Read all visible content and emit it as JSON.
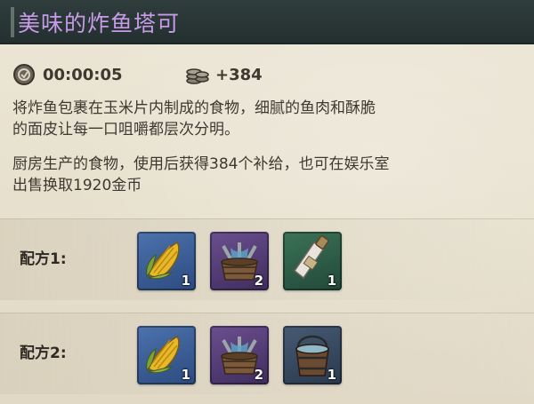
{
  "title": "美味的炸鱼塔可",
  "stats": {
    "time": {
      "icon": "coin-timer-icon",
      "value": "00:00:05"
    },
    "supply": {
      "icon": "coin-stack-icon",
      "value": "+384"
    }
  },
  "description": {
    "line1": "将炸鱼包裹在玉米片内制成的食物，细腻的鱼肉和酥脆",
    "line2": "的面皮让每一口咀嚼都层次分明。",
    "line3": "厨房生产的食物，使用后获得384个补给，也可在娱乐室",
    "line4": "出售换取1920金币"
  },
  "recipes": [
    {
      "label": "配方1:",
      "items": [
        {
          "icon": "corn-icon",
          "qty": "1",
          "rarity": "blue"
        },
        {
          "icon": "fish-basket-icon",
          "qty": "2",
          "rarity": "purple"
        },
        {
          "icon": "salt-bottle-icon",
          "qty": "1",
          "rarity": "green"
        }
      ]
    },
    {
      "label": "配方2:",
      "items": [
        {
          "icon": "corn-icon",
          "qty": "1",
          "rarity": "blue"
        },
        {
          "icon": "fish-basket-icon",
          "qty": "2",
          "rarity": "purple"
        },
        {
          "icon": "water-bucket-icon",
          "qty": "1",
          "rarity": "grey"
        }
      ]
    }
  ]
}
